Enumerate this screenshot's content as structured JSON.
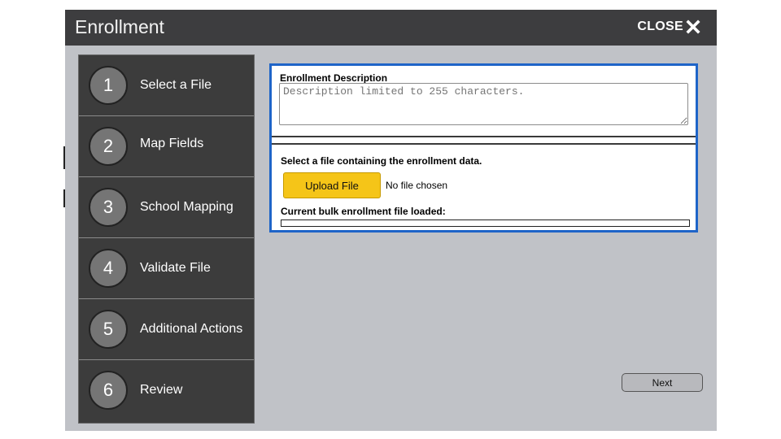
{
  "window": {
    "title": "Enrollment",
    "close_label": "CLOSE",
    "close_icon": "close-x-icon"
  },
  "steps": [
    {
      "number": "1",
      "label": "Select a File"
    },
    {
      "number": "2",
      "label": "Map Fields"
    },
    {
      "number": "3",
      "label": "School Mapping"
    },
    {
      "number": "4",
      "label": "Validate File"
    },
    {
      "number": "5",
      "label": "Additional Actions"
    },
    {
      "number": "6",
      "label": "Review"
    }
  ],
  "description": {
    "label": "Enrollment Description",
    "placeholder": "Description limited to 255 characters.",
    "value": ""
  },
  "file": {
    "prompt": "Select a file containing the enrollment data.",
    "upload_label": "Upload File",
    "status": "No file chosen",
    "current_label": "Current bulk enrollment file loaded:",
    "current_value": ""
  },
  "footer": {
    "next_label": "Next"
  },
  "colors": {
    "titlebar": "#3d3d3f",
    "background": "#c0c2c7",
    "steps_panel": "#3c3c3c",
    "panel_border": "#1e64c8",
    "upload_button": "#f5c518"
  }
}
